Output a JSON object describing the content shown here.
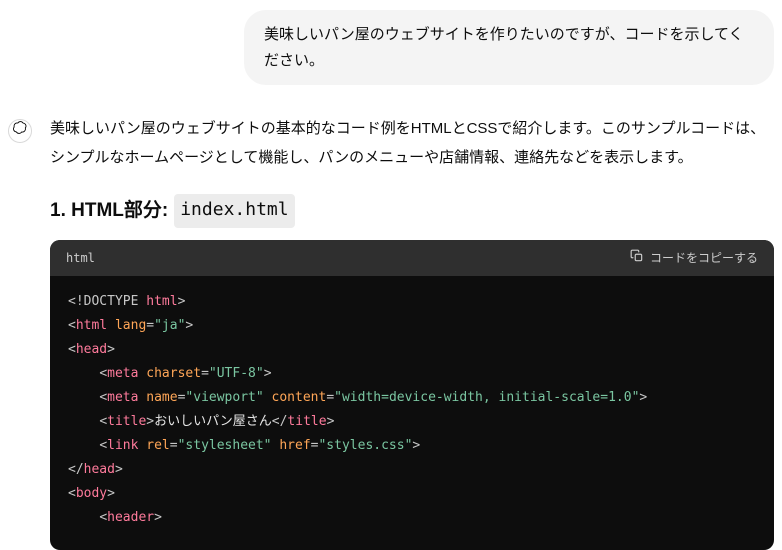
{
  "user": {
    "message": "美味しいパン屋のウェブサイトを作りたいのですが、コードを示してください。"
  },
  "assistant": {
    "intro": "美味しいパン屋のウェブサイトの基本的なコード例をHTMLとCSSで紹介します。このサンプルコードは、シンプルなホームページとして機能し、パンのメニューや店舗情報、連絡先などを表示します。",
    "section1": {
      "prefix": "1. HTML部分:",
      "filename": "index.html"
    },
    "codeblock": {
      "language": "html",
      "copy_label": "コードをコピーする",
      "tokens": [
        [
          {
            "c": "t-doctype",
            "t": "<!"
          },
          {
            "c": "t-doctype",
            "t": "DOCTYPE"
          },
          {
            "c": "t-doctype",
            "t": " "
          },
          {
            "c": "t-html",
            "t": "html"
          },
          {
            "c": "t-doctype",
            "t": ">"
          }
        ],
        [
          {
            "c": "t-punct",
            "t": "<"
          },
          {
            "c": "t-tag",
            "t": "html"
          },
          {
            "c": "t-text",
            "t": " "
          },
          {
            "c": "t-attr",
            "t": "lang"
          },
          {
            "c": "t-punct",
            "t": "="
          },
          {
            "c": "t-str",
            "t": "\"ja\""
          },
          {
            "c": "t-punct",
            "t": ">"
          }
        ],
        [
          {
            "c": "t-punct",
            "t": "<"
          },
          {
            "c": "t-tag",
            "t": "head"
          },
          {
            "c": "t-punct",
            "t": ">"
          }
        ],
        [
          {
            "c": "t-text",
            "t": "    "
          },
          {
            "c": "t-punct",
            "t": "<"
          },
          {
            "c": "t-tag",
            "t": "meta"
          },
          {
            "c": "t-text",
            "t": " "
          },
          {
            "c": "t-attr",
            "t": "charset"
          },
          {
            "c": "t-punct",
            "t": "="
          },
          {
            "c": "t-str",
            "t": "\"UTF-8\""
          },
          {
            "c": "t-punct",
            "t": ">"
          }
        ],
        [
          {
            "c": "t-text",
            "t": "    "
          },
          {
            "c": "t-punct",
            "t": "<"
          },
          {
            "c": "t-tag",
            "t": "meta"
          },
          {
            "c": "t-text",
            "t": " "
          },
          {
            "c": "t-attr",
            "t": "name"
          },
          {
            "c": "t-punct",
            "t": "="
          },
          {
            "c": "t-str",
            "t": "\"viewport\""
          },
          {
            "c": "t-text",
            "t": " "
          },
          {
            "c": "t-attr",
            "t": "content"
          },
          {
            "c": "t-punct",
            "t": "="
          },
          {
            "c": "t-str",
            "t": "\"width=device-width, initial-scale=1.0\""
          },
          {
            "c": "t-punct",
            "t": ">"
          }
        ],
        [
          {
            "c": "t-text",
            "t": "    "
          },
          {
            "c": "t-punct",
            "t": "<"
          },
          {
            "c": "t-tag",
            "t": "title"
          },
          {
            "c": "t-punct",
            "t": ">"
          },
          {
            "c": "t-text",
            "t": "おいしいパン屋さん"
          },
          {
            "c": "t-punct",
            "t": "</"
          },
          {
            "c": "t-tag",
            "t": "title"
          },
          {
            "c": "t-punct",
            "t": ">"
          }
        ],
        [
          {
            "c": "t-text",
            "t": "    "
          },
          {
            "c": "t-punct",
            "t": "<"
          },
          {
            "c": "t-tag",
            "t": "link"
          },
          {
            "c": "t-text",
            "t": " "
          },
          {
            "c": "t-attr",
            "t": "rel"
          },
          {
            "c": "t-punct",
            "t": "="
          },
          {
            "c": "t-str",
            "t": "\"stylesheet\""
          },
          {
            "c": "t-text",
            "t": " "
          },
          {
            "c": "t-attr",
            "t": "href"
          },
          {
            "c": "t-punct",
            "t": "="
          },
          {
            "c": "t-str",
            "t": "\"styles.css\""
          },
          {
            "c": "t-punct",
            "t": ">"
          }
        ],
        [
          {
            "c": "t-punct",
            "t": "</"
          },
          {
            "c": "t-tag",
            "t": "head"
          },
          {
            "c": "t-punct",
            "t": ">"
          }
        ],
        [
          {
            "c": "t-punct",
            "t": "<"
          },
          {
            "c": "t-tag",
            "t": "body"
          },
          {
            "c": "t-punct",
            "t": ">"
          }
        ],
        [
          {
            "c": "t-text",
            "t": "    "
          },
          {
            "c": "t-punct",
            "t": "<"
          },
          {
            "c": "t-tag",
            "t": "header"
          },
          {
            "c": "t-punct",
            "t": ">"
          }
        ]
      ]
    }
  }
}
